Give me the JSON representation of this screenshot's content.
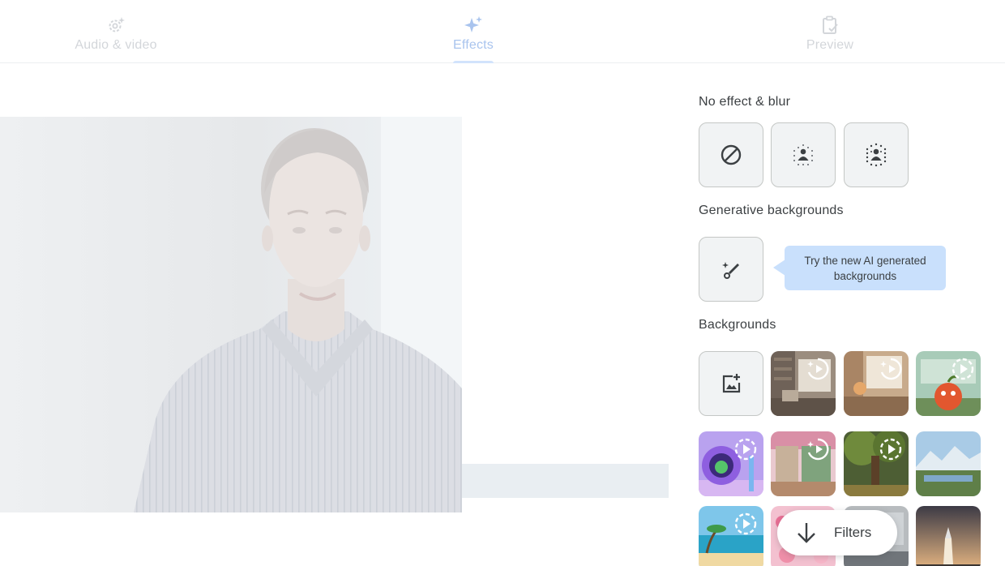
{
  "tabs": [
    {
      "label": "Audio & video",
      "icon": "settings-sparkle-icon"
    },
    {
      "label": "Effects",
      "icon": "sparkle-icon",
      "active": true
    },
    {
      "label": "Preview",
      "icon": "clipboard-check-icon"
    }
  ],
  "sections": {
    "no_effect": "No effect & blur",
    "generative": "Generative backgrounds",
    "backgrounds": "Backgrounds"
  },
  "no_effect_options": [
    "no-effect-icon",
    "slight-blur-icon",
    "full-blur-icon"
  ],
  "generative_option": {
    "icon": "magic-brush-icon"
  },
  "tooltip": "Try the new AI generated backgrounds",
  "backgrounds": {
    "upload_icon": "add-image-icon",
    "thumbnails": [
      {
        "name": "library-room",
        "badge": "sparkle-play-icon"
      },
      {
        "name": "cozy-room",
        "badge": "sparkle-play-icon"
      },
      {
        "name": "classroom-apple",
        "badge": "play-icon"
      },
      {
        "name": "pod-monster",
        "badge": "play-icon"
      },
      {
        "name": "zen-garden",
        "badge": "sparkle-play-icon"
      },
      {
        "name": "forest-tree",
        "badge": "play-icon"
      },
      {
        "name": "mountain-lake",
        "badge": ""
      },
      {
        "name": "beach",
        "badge": "play-icon"
      },
      {
        "name": "flowers",
        "badge": ""
      },
      {
        "name": "office",
        "badge": ""
      },
      {
        "name": "rocket-launch",
        "badge": ""
      }
    ]
  },
  "filters_button": {
    "label": "Filters",
    "icon": "arrow-down-icon"
  },
  "colors": {
    "accent": "#a9c4ee",
    "tooltip_bg": "#c9e0fc",
    "tile_bg": "#f1f3f4"
  }
}
